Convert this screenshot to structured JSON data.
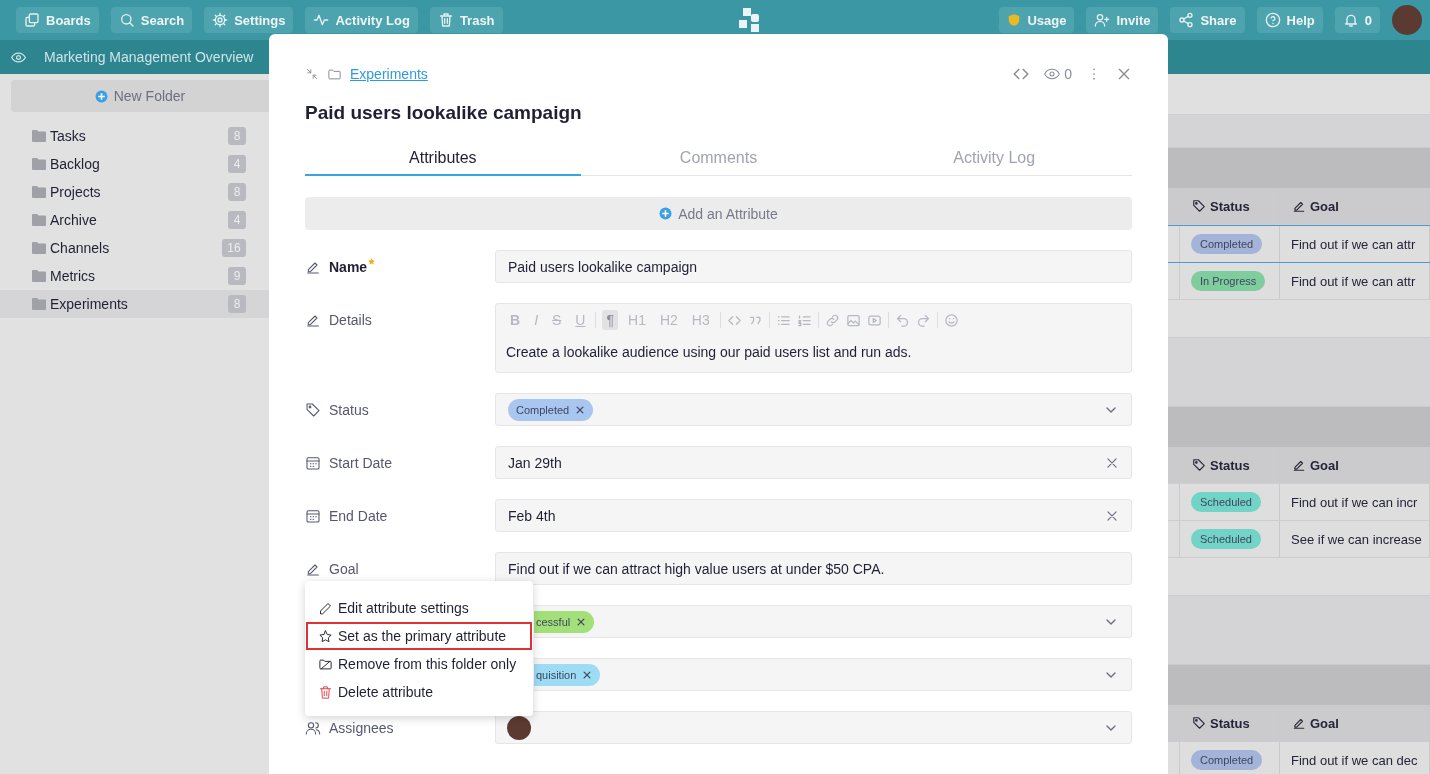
{
  "top_bar": {
    "left_buttons": [
      {
        "kind": "boards",
        "label": "Boards"
      },
      {
        "kind": "search",
        "label": "Search"
      },
      {
        "kind": "settings",
        "label": "Settings"
      },
      {
        "kind": "activity",
        "label": "Activity Log"
      },
      {
        "kind": "trash",
        "label": "Trash"
      }
    ],
    "right_buttons": [
      {
        "kind": "usage",
        "label": "Usage"
      },
      {
        "kind": "invite",
        "label": "Invite"
      },
      {
        "kind": "share",
        "label": "Share"
      },
      {
        "kind": "help",
        "label": "Help"
      },
      {
        "kind": "notifications",
        "label": "0"
      }
    ]
  },
  "project_bar": {
    "title": "Marketing Management Overview"
  },
  "sidebar": {
    "new_folder": "New Folder",
    "folders": [
      {
        "name": "Tasks",
        "count": "8",
        "selected": false
      },
      {
        "name": "Backlog",
        "count": "4",
        "selected": false
      },
      {
        "name": "Projects",
        "count": "8",
        "selected": false
      },
      {
        "name": "Archive",
        "count": "4",
        "selected": false
      },
      {
        "name": "Channels",
        "count": "16",
        "selected": false
      },
      {
        "name": "Metrics",
        "count": "9",
        "selected": false
      },
      {
        "name": "Experiments",
        "count": "8",
        "selected": true
      }
    ]
  },
  "board": {
    "groups": [
      {
        "columns": [
          "Status",
          "Goal"
        ],
        "rows": [
          {
            "status": {
              "label": "Completed",
              "color": "#a3b4d8"
            },
            "goal": "Find out if we can attr",
            "selected": true
          },
          {
            "status": {
              "label": "In Progress",
              "color": "#7fcc9c"
            },
            "goal": "Find out if we can attr",
            "selected": false
          }
        ]
      },
      {
        "columns": [
          "Status",
          "Goal"
        ],
        "rows": [
          {
            "status": {
              "label": "Scheduled",
              "color": "#72d4c6"
            },
            "goal": "Find out if we can incr",
            "selected": false
          },
          {
            "status": {
              "label": "Scheduled",
              "color": "#72d4c6"
            },
            "goal": "See if we can increase",
            "selected": false
          }
        ]
      },
      {
        "columns": [
          "Status",
          "Goal"
        ],
        "rows": [
          {
            "status": {
              "label": "Completed",
              "color": "#a3b4d8"
            },
            "goal": "Find out if we can dec",
            "selected": false
          }
        ]
      }
    ]
  },
  "modal": {
    "folder": "Experiments",
    "view_count": "0",
    "title": "Paid users lookalike campaign",
    "tabs": [
      {
        "label": "Attributes",
        "selected": true
      },
      {
        "label": "Comments",
        "selected": false
      },
      {
        "label": "Activity Log",
        "selected": false
      }
    ],
    "add_attribute": "Add an Attribute",
    "details_toolbar": [
      {
        "label": "B",
        "selected": false
      },
      {
        "label": "I",
        "selected": false
      },
      {
        "label": "S",
        "selected": false
      },
      {
        "label": "U",
        "selected": false
      },
      {
        "label": "¶",
        "selected": true
      },
      {
        "label": "H1",
        "selected": false
      },
      {
        "label": "H2",
        "selected": false
      },
      {
        "label": "H3",
        "selected": false
      }
    ],
    "attributes": [
      {
        "kind": "text",
        "label": "Name",
        "required": true,
        "value": "Paid users lookalike campaign"
      },
      {
        "kind": "richtext",
        "label": "Details",
        "required": false,
        "value": "Create a lookalike audience using our paid users list and run ads."
      },
      {
        "kind": "tags",
        "label": "Status",
        "required": false,
        "tags": [
          {
            "label": "Completed",
            "color": "#a9c6f0"
          }
        ]
      },
      {
        "kind": "date",
        "label": "Start Date",
        "required": false,
        "value": "Jan 29th"
      },
      {
        "kind": "date",
        "label": "End Date",
        "required": false,
        "value": "Feb 4th"
      },
      {
        "kind": "text",
        "label": "Goal",
        "required": false,
        "value": "Find out if we can attract high value users at under $50 CPA."
      },
      {
        "kind": "tags",
        "required": false,
        "tags": [
          {
            "label": "cessful",
            "color": "#a3e07a"
          }
        ]
      },
      {
        "kind": "tags",
        "required": false,
        "tags": [
          {
            "label": "quisition",
            "color": "#9edcf5"
          }
        ]
      },
      {
        "kind": "assignees",
        "label": "Assignees",
        "required": false
      }
    ]
  },
  "menu": {
    "items": [
      {
        "kind": "edit",
        "label": "Edit attribute settings",
        "highlighted": false
      },
      {
        "kind": "primary",
        "label": "Set as the primary attribute",
        "highlighted": true
      },
      {
        "kind": "remove",
        "label": "Remove from this folder only",
        "highlighted": false
      },
      {
        "kind": "delete",
        "label": "Delete attribute",
        "highlighted": false
      }
    ]
  }
}
